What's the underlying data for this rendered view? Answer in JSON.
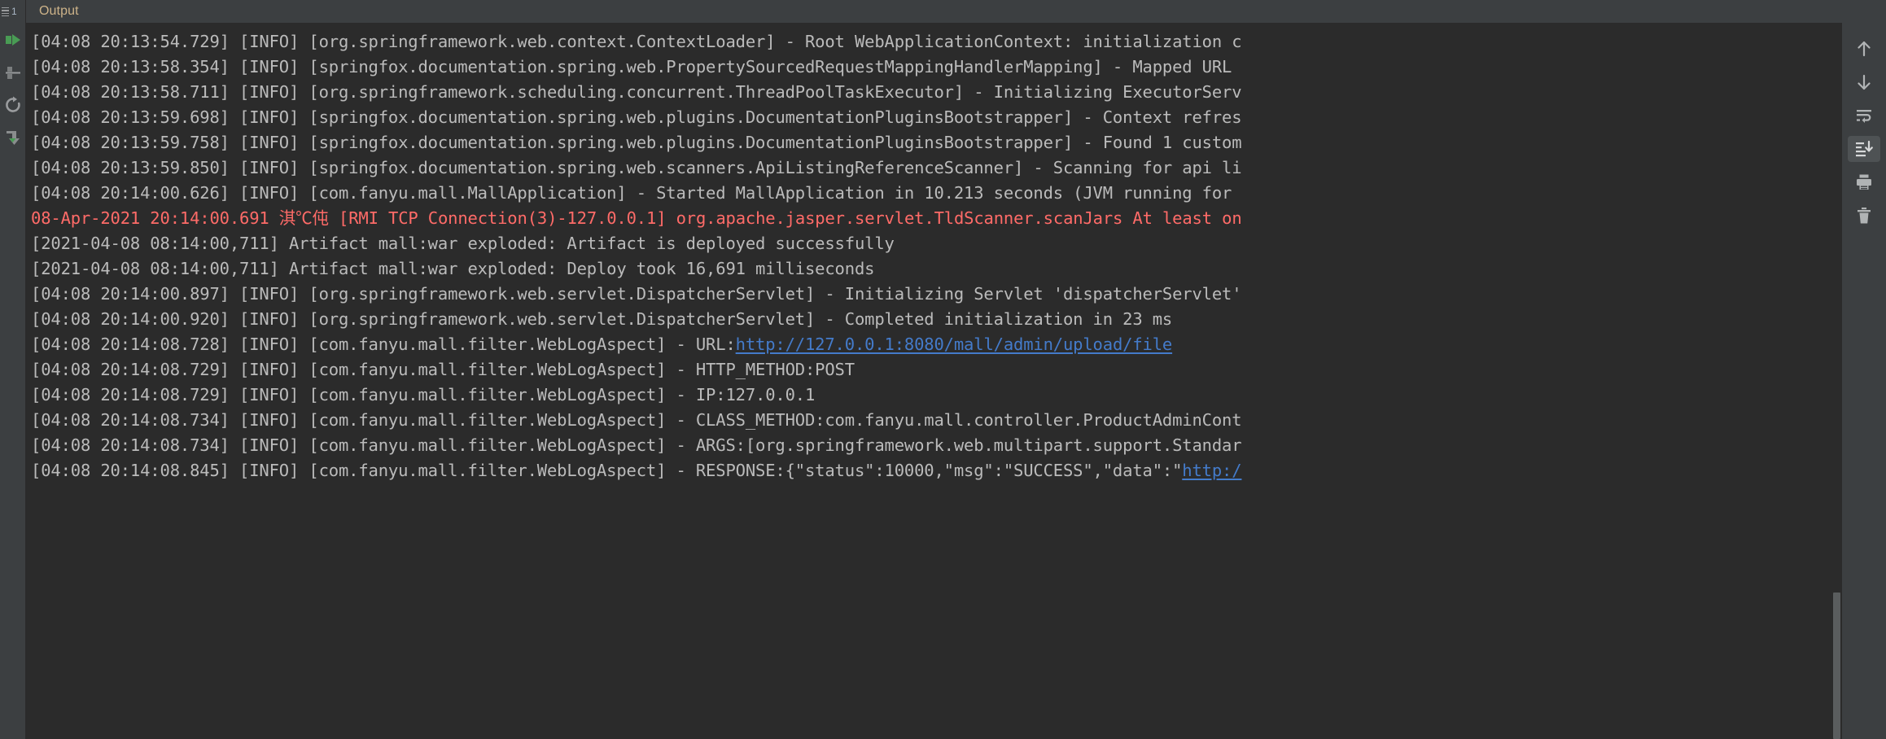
{
  "window": {
    "title": "Output",
    "tab_label": "Output",
    "gutter_number": "1"
  },
  "colors": {
    "background": "#3c3f41",
    "console_background": "#2b2b2b",
    "text": "#bbbbbb",
    "error": "#ff6b68",
    "link": "#447bca",
    "tab_text": "#cdb389",
    "toolbar_selected": "#4e5254",
    "scrollbar_thumb": "#5a5d5e"
  },
  "left_gutter": {
    "icons": [
      {
        "name": "rerun-icon",
        "label": "Rerun"
      },
      {
        "name": "stop-icon",
        "label": "Stop"
      },
      {
        "name": "restart-icon",
        "label": "Restart"
      },
      {
        "name": "resume-icon",
        "label": "Resume Program"
      }
    ]
  },
  "right_toolbar": {
    "icons": [
      {
        "name": "up-arrow-icon",
        "label": "Up the Stack Trace",
        "selected": false
      },
      {
        "name": "down-arrow-icon",
        "label": "Down the Stack Trace",
        "selected": false
      },
      {
        "name": "soft-wrap-icon",
        "label": "Soft-Wrap",
        "selected": false
      },
      {
        "name": "scroll-to-end-icon",
        "label": "Scroll to the End",
        "selected": true
      },
      {
        "name": "print-icon",
        "label": "Print",
        "selected": false
      },
      {
        "name": "trash-icon",
        "label": "Clear All",
        "selected": false
      }
    ]
  },
  "console": {
    "lines": [
      {
        "id": "line-1",
        "type": "info",
        "segments": [
          {
            "text": "[04:08 20:13:54.729] [INFO] [org.springframework.web.context.ContextLoader] - Root WebApplicationContext: initialization c",
            "kind": "text"
          }
        ]
      },
      {
        "id": "line-2",
        "type": "info",
        "segments": [
          {
            "text": "[04:08 20:13:58.354] [INFO] [springfox.documentation.spring.web.PropertySourcedRequestMappingHandlerMapping] - Mapped URL",
            "kind": "text"
          }
        ]
      },
      {
        "id": "line-3",
        "type": "info",
        "segments": [
          {
            "text": "[04:08 20:13:58.711] [INFO] [org.springframework.scheduling.concurrent.ThreadPoolTaskExecutor] - Initializing ExecutorServ",
            "kind": "text"
          }
        ]
      },
      {
        "id": "line-4",
        "type": "info",
        "segments": [
          {
            "text": "[04:08 20:13:59.698] [INFO] [springfox.documentation.spring.web.plugins.DocumentationPluginsBootstrapper] - Context refres",
            "kind": "text"
          }
        ]
      },
      {
        "id": "line-5",
        "type": "info",
        "segments": [
          {
            "text": "[04:08 20:13:59.758] [INFO] [springfox.documentation.spring.web.plugins.DocumentationPluginsBootstrapper] - Found 1 custom",
            "kind": "text"
          }
        ]
      },
      {
        "id": "line-6",
        "type": "info",
        "segments": [
          {
            "text": "[04:08 20:13:59.850] [INFO] [springfox.documentation.spring.web.scanners.ApiListingReferenceScanner] - Scanning for api li",
            "kind": "text"
          }
        ]
      },
      {
        "id": "line-7",
        "type": "info",
        "segments": [
          {
            "text": "[04:08 20:14:00.626] [INFO] [com.fanyu.mall.MallApplication] - Started MallApplication in 10.213 seconds (JVM running for",
            "kind": "text"
          }
        ]
      },
      {
        "id": "line-8",
        "type": "error",
        "segments": [
          {
            "text": "08-Apr-2021 20:14:00.691 淇℃伅 [RMI TCP Connection(3)-127.0.0.1] org.apache.jasper.servlet.TldScanner.scanJars At least on",
            "kind": "text"
          }
        ]
      },
      {
        "id": "line-9",
        "type": "system",
        "segments": [
          {
            "text": "[2021-04-08 08:14:00,711] Artifact mall:war exploded: Artifact is deployed successfully",
            "kind": "text"
          }
        ]
      },
      {
        "id": "line-10",
        "type": "system",
        "segments": [
          {
            "text": "[2021-04-08 08:14:00,711] Artifact mall:war exploded: Deploy took 16,691 milliseconds",
            "kind": "text"
          }
        ]
      },
      {
        "id": "line-11",
        "type": "info",
        "segments": [
          {
            "text": "[04:08 20:14:00.897] [INFO] [org.springframework.web.servlet.DispatcherServlet] - Initializing Servlet 'dispatcherServlet'",
            "kind": "text"
          }
        ]
      },
      {
        "id": "line-12",
        "type": "info",
        "segments": [
          {
            "text": "[04:08 20:14:00.920] [INFO] [org.springframework.web.servlet.DispatcherServlet] - Completed initialization in 23 ms",
            "kind": "text"
          }
        ]
      },
      {
        "id": "line-13",
        "type": "info",
        "segments": [
          {
            "text": "[04:08 20:14:08.728] [INFO] [com.fanyu.mall.filter.WebLogAspect] - URL:",
            "kind": "text"
          },
          {
            "text": "http://127.0.0.1:8080/mall/admin/upload/file",
            "kind": "link"
          }
        ]
      },
      {
        "id": "line-14",
        "type": "info",
        "segments": [
          {
            "text": "[04:08 20:14:08.729] [INFO] [com.fanyu.mall.filter.WebLogAspect] - HTTP_METHOD:POST",
            "kind": "text"
          }
        ]
      },
      {
        "id": "line-15",
        "type": "info",
        "segments": [
          {
            "text": "[04:08 20:14:08.729] [INFO] [com.fanyu.mall.filter.WebLogAspect] - IP:127.0.0.1",
            "kind": "text"
          }
        ]
      },
      {
        "id": "line-16",
        "type": "info",
        "segments": [
          {
            "text": "[04:08 20:14:08.734] [INFO] [com.fanyu.mall.filter.WebLogAspect] - CLASS_METHOD:com.fanyu.mall.controller.ProductAdminCont",
            "kind": "text"
          }
        ]
      },
      {
        "id": "line-17",
        "type": "info",
        "segments": [
          {
            "text": "[04:08 20:14:08.734] [INFO] [com.fanyu.mall.filter.WebLogAspect] - ARGS:[org.springframework.web.multipart.support.Standar",
            "kind": "text"
          }
        ]
      },
      {
        "id": "line-18",
        "type": "info",
        "segments": [
          {
            "text": "[04:08 20:14:08.845] [INFO] [com.fanyu.mall.filter.WebLogAspect] - RESPONSE:{\"status\":10000,\"msg\":\"SUCCESS\",\"data\":\"",
            "kind": "text"
          },
          {
            "text": "http:/",
            "kind": "link"
          }
        ]
      }
    ]
  }
}
